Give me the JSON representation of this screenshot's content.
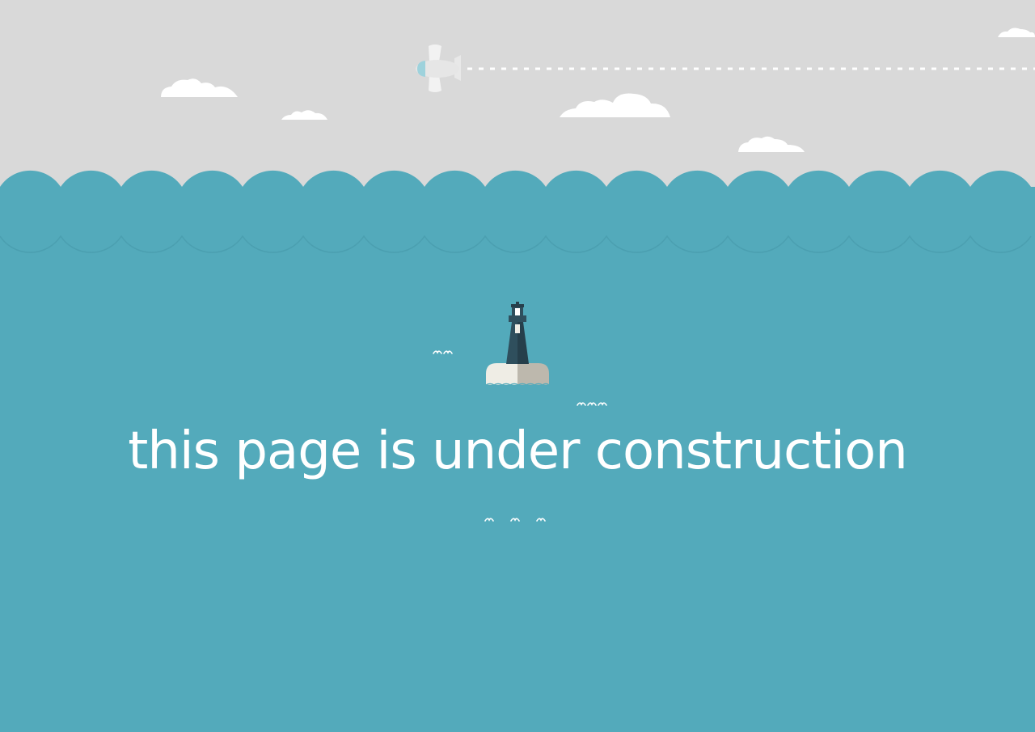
{
  "message": {
    "headline": "this page is under construction"
  },
  "colors": {
    "sky": "#d9d9d9",
    "sea": "#53aabb",
    "wave_line": "#4b9fb0",
    "cloud": "#ffffff",
    "text": "#ffffff",
    "lighthouse_tower": "#2f4f5d",
    "lighthouse_shadow": "#263f4b",
    "rock_light": "#efede5",
    "rock_shadow": "#bdb8ad"
  },
  "icons": [
    "airplane-icon",
    "lighthouse-icon",
    "cloud-icon",
    "seagull-icon"
  ]
}
